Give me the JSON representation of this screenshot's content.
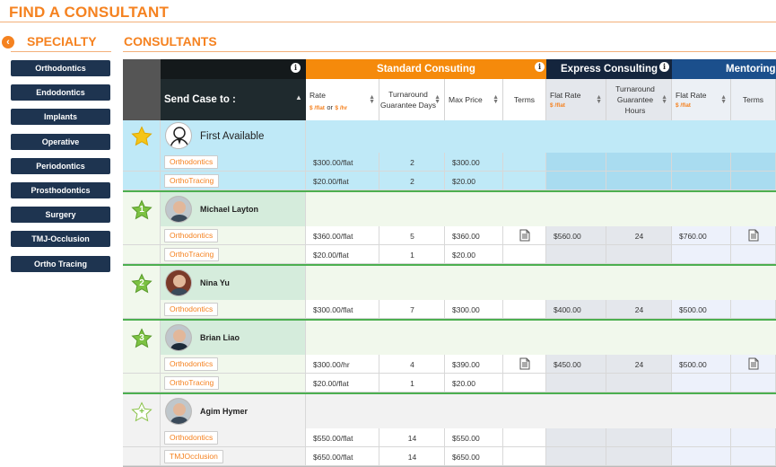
{
  "page": {
    "title": "FIND A CONSULTANT"
  },
  "sidebar": {
    "title": "SPECIALTY",
    "items": [
      "Orthodontics",
      "Endodontics",
      "Implants",
      "Operative",
      "Periodontics",
      "Prosthodontics",
      "Surgery",
      "TMJ-Occlusion",
      "Ortho Tracing"
    ]
  },
  "main": {
    "title": "CONSULTANTS"
  },
  "header": {
    "send_case": "Send Case to :",
    "groups": {
      "standard": "Standard Consuting",
      "express": "Express Consulting",
      "mentoring": "Mentoring"
    },
    "std_cols": {
      "rate": "Rate",
      "rate_flat": "$ /flat",
      "rate_or": "or",
      "rate_hr": "$ /hr",
      "turnaround": "Turnaround Guarantee Days",
      "max_price": "Max Price",
      "terms": "Terms"
    },
    "exp_cols": {
      "flat_rate": "Flat Rate",
      "flat_unit": "$ /flat",
      "turnaround": "Turnaround Guarantee Hours"
    },
    "men_cols": {
      "flat_rate": "Flat Rate",
      "flat_unit": "$ /flat",
      "terms": "Terms"
    }
  },
  "consultants": [
    {
      "name": "First Available",
      "rank": "star",
      "services": [
        {
          "tag": "Orthodontics",
          "rate": "$300.00/flat",
          "days": "2",
          "max": "$300.00",
          "exp_rate": "",
          "exp_hours": "",
          "men_rate": ""
        },
        {
          "tag": "OrthoTracing",
          "rate": "$20.00/flat",
          "days": "2",
          "max": "$20.00",
          "exp_rate": "",
          "exp_hours": "",
          "men_rate": ""
        }
      ]
    },
    {
      "name": "Michael Layton",
      "rank": "1",
      "services": [
        {
          "tag": "Orthodontics",
          "rate": "$360.00/flat",
          "days": "5",
          "max": "$360.00",
          "exp_rate": "$560.00",
          "exp_hours": "24",
          "men_rate": "$760.00"
        },
        {
          "tag": "OrthoTracing",
          "rate": "$20.00/flat",
          "days": "1",
          "max": "$20.00",
          "exp_rate": "",
          "exp_hours": "",
          "men_rate": ""
        }
      ]
    },
    {
      "name": "Nina Yu",
      "rank": "2",
      "services": [
        {
          "tag": "Orthodontics",
          "rate": "$300.00/flat",
          "days": "7",
          "max": "$300.00",
          "exp_rate": "$400.00",
          "exp_hours": "24",
          "men_rate": "$500.00"
        }
      ]
    },
    {
      "name": "Brian Liao",
      "rank": "3",
      "services": [
        {
          "tag": "Orthodontics",
          "rate": "$300.00/hr",
          "days": "4",
          "max": "$390.00",
          "exp_rate": "$450.00",
          "exp_hours": "24",
          "men_rate": "$500.00"
        },
        {
          "tag": "OrthoTracing",
          "rate": "$20.00/flat",
          "days": "1",
          "max": "$20.00",
          "exp_rate": "",
          "exp_hours": "",
          "men_rate": ""
        }
      ]
    },
    {
      "name": "Agim Hymer",
      "rank": "plus",
      "services": [
        {
          "tag": "Orthodontics",
          "rate": "$550.00/flat",
          "days": "14",
          "max": "$550.00",
          "exp_rate": "",
          "exp_hours": "",
          "men_rate": ""
        },
        {
          "tag": "TMJOcclusion",
          "rate": "$650.00/flat",
          "days": "14",
          "max": "$650.00",
          "exp_rate": "",
          "exp_hours": "",
          "men_rate": ""
        }
      ]
    }
  ],
  "colors": {
    "accent": "#f58220",
    "navy": "#1e3450",
    "first_bg": "#bfe9f7",
    "ranked_bg": "#f1f8ec",
    "name_cell": "#d5ecdc",
    "plain_bg": "#f2f2f2",
    "rule": "#4caf50"
  }
}
